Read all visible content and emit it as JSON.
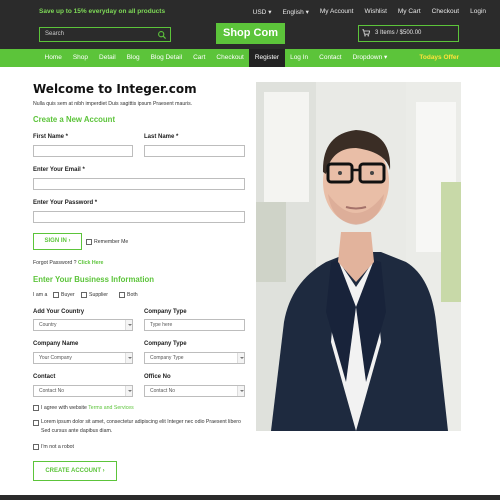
{
  "topbar": {
    "promo": "Save up to 15% everyday on all products",
    "links": [
      "USD",
      "English",
      "My Account",
      "Wishlist",
      "My Cart",
      "Checkout",
      "Login"
    ],
    "search_placeholder": "Search",
    "logo": "Shop Com",
    "cart": "3 Items / $500.00"
  },
  "nav": {
    "items": [
      "Home",
      "Shop",
      "Detail",
      "Blog",
      "Blog Detail",
      "Cart",
      "Checkout",
      "Register",
      "Log In",
      "Contact",
      "Dropdown"
    ],
    "active": "Register",
    "todays_offer": "Todays Offer"
  },
  "form": {
    "title": "Welcome to Integer.com",
    "subtitle": "Nulla quis sem at nibh imperdiet Duis sagittis ipsum Praesent mauris.",
    "new_account": "Create a New Account",
    "first_name": "First Name *",
    "last_name": "Last Name *",
    "email": "Enter Your Email *",
    "password": "Enter Your Password *",
    "signin": "SIGN IN",
    "remember": "Remember Me",
    "forgot": "Forgot Password ?",
    "click_here": "Click Here",
    "business_title": "Enter Your Business Information",
    "i_am": "I am a",
    "buyer": "Buyer",
    "supplier": "Supplier",
    "both": "Both",
    "add_country": "Add Your Country",
    "country_value": "Country",
    "company_type_label": "Company Type",
    "company_type_placeholder": "Type here",
    "company_name": "Company Name",
    "your_company": "Your Company",
    "company_type2": "Company Type",
    "company_type_value": "Company Type",
    "contact": "Contact",
    "contact_value": "Contact No",
    "office_no": "Office No",
    "office_value": "Contact No",
    "agree_prefix": "I agree with website",
    "agree_link": "Terms and Services",
    "lorem": "Lorem ipsum dolor sit amet, consectetur adipiscing elit Integer nec odio Praesent libero Sed cursus ante dapibus diam.",
    "robot": "I'm not a robot",
    "create": "CREATE ACCOUNT"
  },
  "colors": {
    "accent": "#5cc43a",
    "dark": "#2b2b2b",
    "offer": "#ffe23a"
  }
}
